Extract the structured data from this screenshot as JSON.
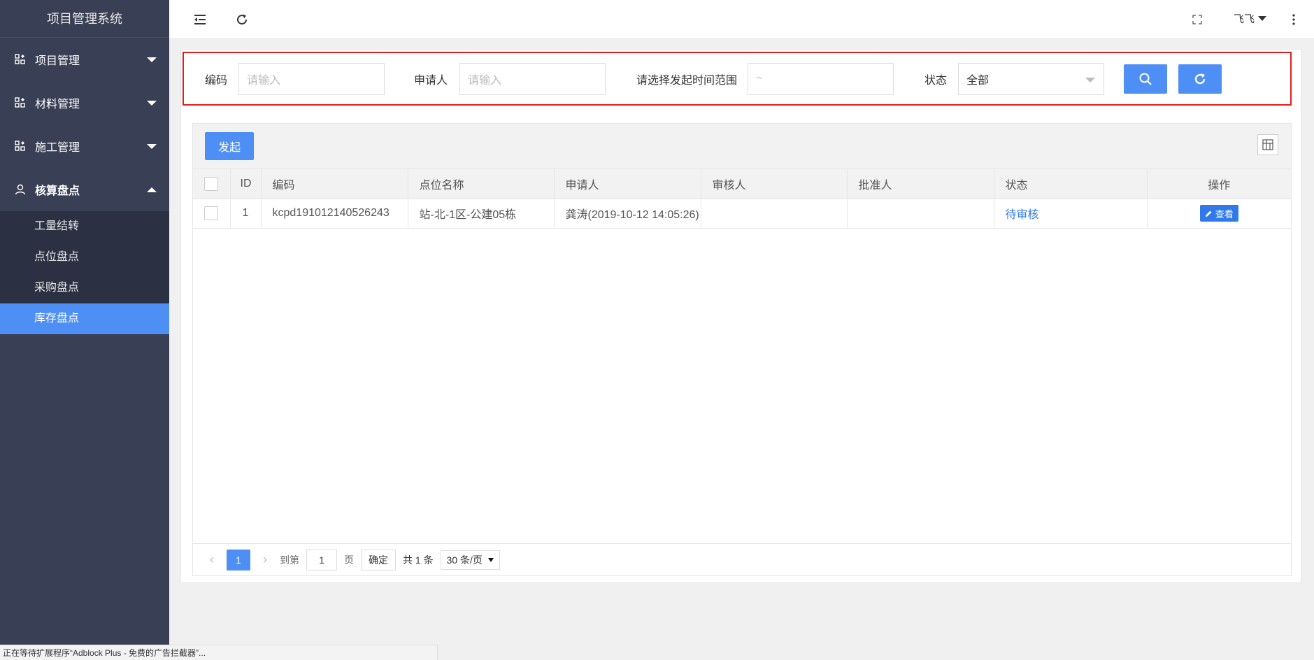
{
  "app": {
    "title": "项目管理系统"
  },
  "sidebar": {
    "menus": [
      {
        "label": "项目管理",
        "expanded": false
      },
      {
        "label": "材料管理",
        "expanded": false
      },
      {
        "label": "施工管理",
        "expanded": false
      },
      {
        "label": "核算盘点",
        "expanded": true
      }
    ],
    "submenu": [
      "工量结转",
      "点位盘点",
      "采购盘点",
      "库存盘点"
    ],
    "active_submenu": "库存盘点"
  },
  "topbar": {
    "user_name": "飞飞"
  },
  "search": {
    "code_label": "编码",
    "code_placeholder": "请输入",
    "applicant_label": "申请人",
    "applicant_placeholder": "请输入",
    "time_label": "请选择发起时间范围",
    "time_placeholder": "~",
    "status_label": "状态",
    "status_value": "全部"
  },
  "toolbar": {
    "launch_label": "发起"
  },
  "table": {
    "headers": [
      "ID",
      "编码",
      "点位名称",
      "申请人",
      "审核人",
      "批准人",
      "状态",
      "操作"
    ],
    "rows": [
      {
        "id": "1",
        "code": "kcpd191012140526243",
        "location": "站-北-1区-公建05栋",
        "applicant": "龚涛(2019-10-12 14:05:26)",
        "reviewer": "",
        "approver": "",
        "status": "待审核",
        "action": "查看"
      }
    ]
  },
  "pager": {
    "current_page": "1",
    "goto_label": "到第",
    "goto_value": "1",
    "page_unit": "页",
    "confirm_label": "确定",
    "total_label": "共 1 条",
    "page_size": "30 条/页"
  },
  "browser_status": "正在等待扩展程序“Adblock Plus - 免费的广告拦截器”..."
}
